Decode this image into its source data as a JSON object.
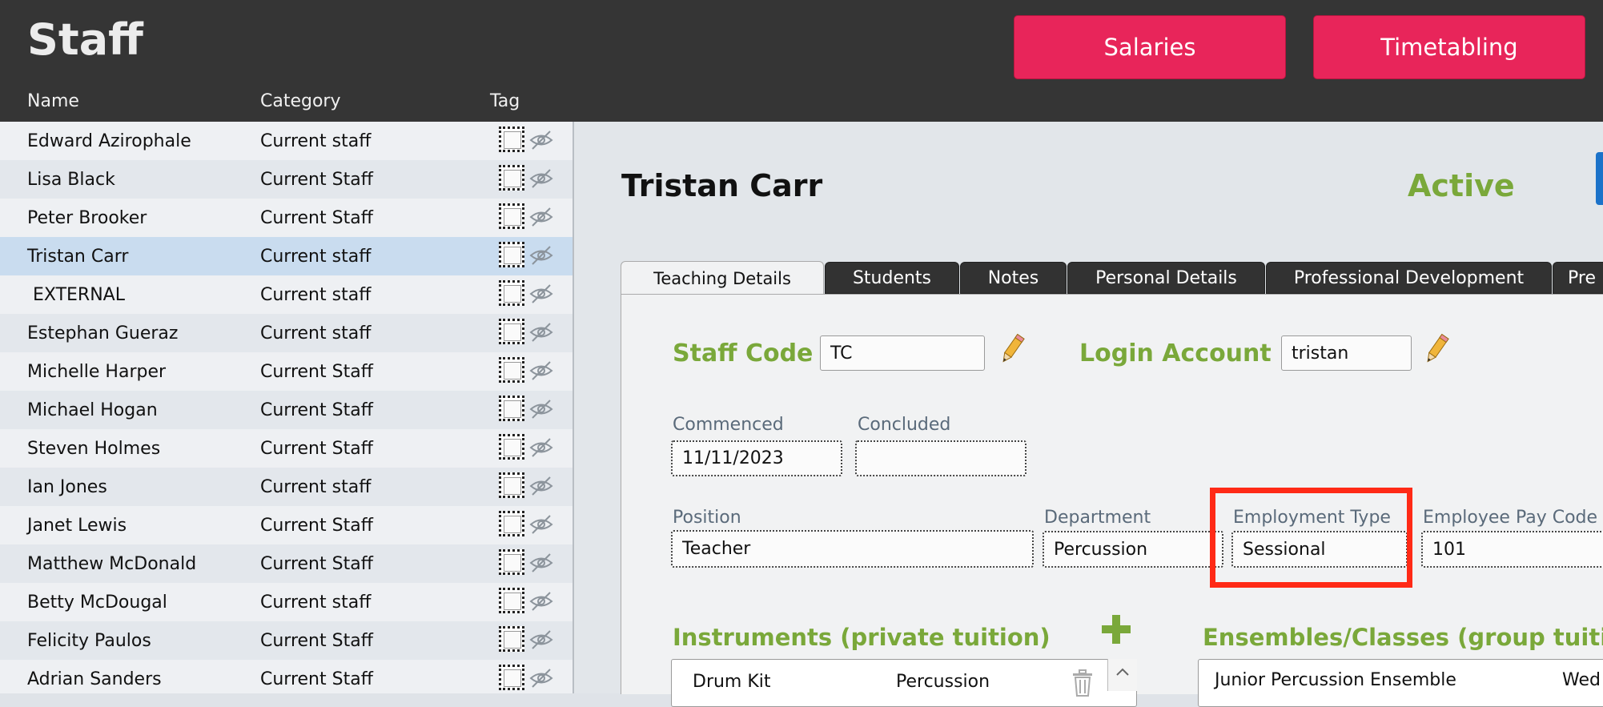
{
  "header": {
    "title": "Staff",
    "buttons": {
      "salaries": "Salaries",
      "timetabling": "Timetabling"
    },
    "columns": {
      "name": "Name",
      "category": "Category",
      "tag": "Tag"
    }
  },
  "staff_list": [
    {
      "name": "Edward Azirophale",
      "category": "Current staff"
    },
    {
      "name": "Lisa Black",
      "category": "Current Staff"
    },
    {
      "name": "Peter Brooker",
      "category": "Current Staff"
    },
    {
      "name": "Tristan Carr",
      "category": "Current staff",
      "selected": true
    },
    {
      "name": " EXTERNAL",
      "category": "Current staff"
    },
    {
      "name": "Estephan Gueraz",
      "category": "Current staff"
    },
    {
      "name": "Michelle Harper",
      "category": "Current Staff"
    },
    {
      "name": "Michael Hogan",
      "category": "Current Staff"
    },
    {
      "name": "Steven Holmes",
      "category": "Current Staff"
    },
    {
      "name": "Ian Jones",
      "category": "Current staff"
    },
    {
      "name": "Janet Lewis",
      "category": "Current Staff"
    },
    {
      "name": "Matthew McDonald",
      "category": "Current Staff"
    },
    {
      "name": "Betty McDougal",
      "category": "Current staff"
    },
    {
      "name": "Felicity Paulos",
      "category": "Current Staff"
    },
    {
      "name": "Adrian Sanders",
      "category": "Current Staff"
    }
  ],
  "detail": {
    "name": "Tristan Carr",
    "status": "Active",
    "tabs": [
      "Teaching Details",
      "Students",
      "Notes",
      "Personal Details",
      "Professional Development",
      "Pre"
    ],
    "staff_code_label": "Staff Code",
    "staff_code": "TC",
    "login_account_label": "Login Account",
    "login_account": "tristan",
    "commenced_label": "Commenced",
    "commenced": "11/11/2023",
    "concluded_label": "Concluded",
    "concluded": "",
    "position_label": "Position",
    "position": "Teacher",
    "department_label": "Department",
    "department": "Percussion",
    "employment_type_label": "Employment Type",
    "employment_type": "Sessional",
    "pay_code_label": "Employee Pay Code",
    "pay_code": "101",
    "instruments_heading": "Instruments (private tuition)",
    "instruments": [
      {
        "instrument": "Drum Kit",
        "department": "Percussion"
      }
    ],
    "ensembles_heading": "Ensembles/Classes (group tuiti",
    "ensembles": [
      {
        "name": "Junior Percussion Ensemble",
        "day": "Wed"
      }
    ]
  },
  "colors": {
    "header_bg": "#353535",
    "button_pink": "#e8255a",
    "accent_green": "#7aa83a",
    "highlight_red": "#ff2a16",
    "selected_row": "#c9dcef"
  },
  "icons": [
    "hidden-eye-icon",
    "pencil-icon",
    "plus-icon",
    "trash-icon",
    "chevron-up-icon"
  ]
}
